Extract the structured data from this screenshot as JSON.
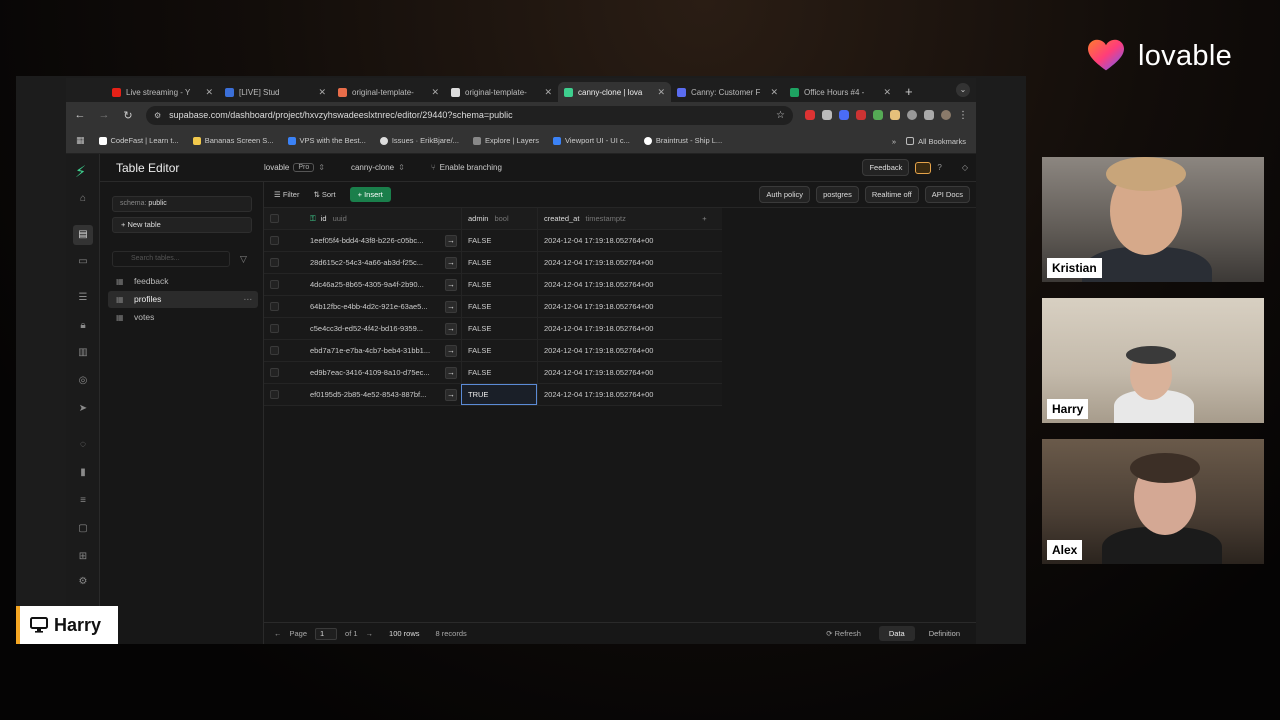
{
  "brand": {
    "name": "lovable"
  },
  "browser": {
    "tabs": [
      {
        "label": "Live streaming - Y",
        "color": "#e62117"
      },
      {
        "label": "[LIVE] Stud",
        "color": "#3b6fd8"
      },
      {
        "label": "original-template-",
        "color": "#e86d4a"
      },
      {
        "label": "original-template-",
        "color": "#dddddd"
      },
      {
        "label": "canny-clone | lova",
        "color": "#3ecf8e",
        "active": true
      },
      {
        "label": "Canny: Customer F",
        "color": "#5a6cf0"
      },
      {
        "label": "Office Hours #4 - ",
        "color": "#1ea362"
      }
    ],
    "url": "supabase.com/dashboard/project/hxvzyhswadeeslxtnrec/editor/29440?schema=public",
    "bookmarks": [
      {
        "label": "CodeFast | Learn t...",
        "color": "#ffffff"
      },
      {
        "label": "Bananas Screen S...",
        "color": "#f2c94c"
      },
      {
        "label": "VPS with the Best...",
        "color": "#3b82f6"
      },
      {
        "label": "Issues · ErikBjare/...",
        "color": "#dddddd"
      },
      {
        "label": "Explore | Layers",
        "color": "#888888"
      },
      {
        "label": "Viewport UI - UI c...",
        "color": "#3b82f6"
      },
      {
        "label": "Braintrust - Ship L...",
        "color": "#ffffff"
      }
    ],
    "all_bookmarks": "All Bookmarks"
  },
  "app": {
    "title": "Table Editor",
    "org": "lovable",
    "plan": "Pro",
    "project": "canny-clone",
    "branching": "Enable branching",
    "feedback": "Feedback",
    "schema_label": "schema:",
    "schema_value": "public",
    "new_table": "New table",
    "search_placeholder": "Search tables...",
    "tables": [
      "feedback",
      "profiles",
      "votes"
    ],
    "active_table": "profiles",
    "toolbar": {
      "filter": "Filter",
      "sort": "Sort",
      "insert": "Insert",
      "auth_policy": "Auth policy",
      "role": "postgres",
      "realtime": "Realtime off",
      "api_docs": "API Docs"
    },
    "columns": [
      {
        "name": "id",
        "type": "uuid"
      },
      {
        "name": "admin",
        "type": "bool"
      },
      {
        "name": "created_at",
        "type": "timestamptz"
      }
    ],
    "rows": [
      {
        "id": "1eef05f4-bdd4-43f8-b226-c05bc...",
        "admin": "FALSE",
        "created_at": "2024-12-04 17:19:18.052764+00"
      },
      {
        "id": "28d615c2-54c3-4a66-ab3d-f25c...",
        "admin": "FALSE",
        "created_at": "2024-12-04 17:19:18.052764+00"
      },
      {
        "id": "4dc46a25-8b65-4305-9a4f-2b90...",
        "admin": "FALSE",
        "created_at": "2024-12-04 17:19:18.052764+00"
      },
      {
        "id": "64b12fbc-e4bb-4d2c-921e-63ae5...",
        "admin": "FALSE",
        "created_at": "2024-12-04 17:19:18.052764+00"
      },
      {
        "id": "c5e4cc3d-ed52-4f42-bd16-9359...",
        "admin": "FALSE",
        "created_at": "2024-12-04 17:19:18.052764+00"
      },
      {
        "id": "ebd7a71e-e7ba-4cb7-beb4-31bb1...",
        "admin": "FALSE",
        "created_at": "2024-12-04 17:19:18.052764+00"
      },
      {
        "id": "ed9b7eac-3416-4109-8a10-d75ec...",
        "admin": "FALSE",
        "created_at": "2024-12-04 17:19:18.052764+00"
      },
      {
        "id": "ef0195d5-2b85-4e52-8543-887bf...",
        "admin": "TRUE",
        "created_at": "2024-12-04 17:19:18.052764+00",
        "selected": true
      }
    ],
    "footer": {
      "page_label": "Page",
      "page_value": "1",
      "of": "of 1",
      "rows_per_page": "100 rows",
      "record_count": "8 records",
      "refresh": "Refresh",
      "data": "Data",
      "definition": "Definition"
    }
  },
  "participants": [
    {
      "name": "Kristian",
      "bg": "#6f6a64"
    },
    {
      "name": "Harry",
      "bg": "#c9c0b3"
    },
    {
      "name": "Alex",
      "bg": "#5a4c40"
    }
  ],
  "presenter": {
    "name": "Harry"
  }
}
